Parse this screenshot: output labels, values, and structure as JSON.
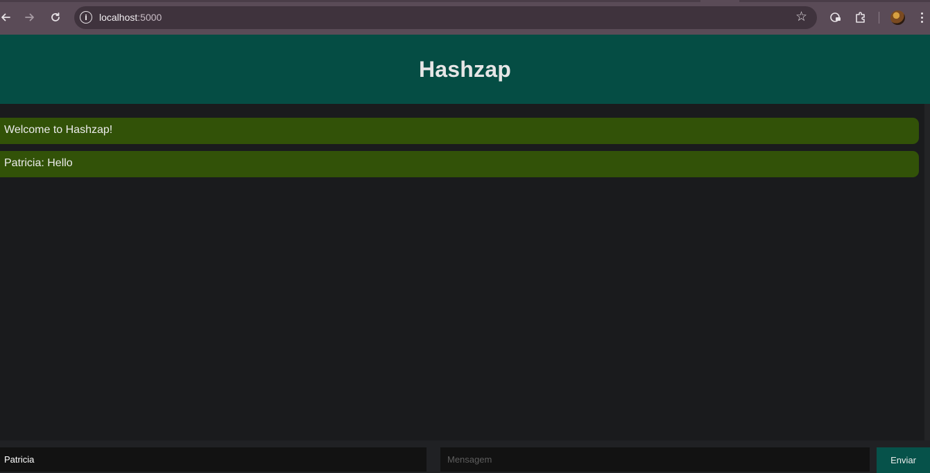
{
  "browser": {
    "url_host": "localhost",
    "url_port": ":5000",
    "icons": {
      "back": "arrow-left-icon",
      "forward": "arrow-right-icon",
      "reload": "reload-icon",
      "site_info": "info-icon",
      "bookmark": "star-icon",
      "extension_a": "guest-icon",
      "extensions": "puzzle-icon",
      "menu": "kebab-menu-icon"
    },
    "colors": {
      "frame": "#5a4b57",
      "omnibox": "#3f333d"
    }
  },
  "app": {
    "title": "Hashzap",
    "messages": [
      {
        "text": "Welcome to Hashzap!"
      },
      {
        "text": "Patricia: Hello"
      }
    ],
    "name_input": {
      "value": "Patricia",
      "placeholder": ""
    },
    "message_input": {
      "value": "",
      "placeholder": "Mensagem"
    },
    "send_label": "Enviar",
    "colors": {
      "header": "#054d44",
      "message_bubble": "#325208",
      "background": "#1a1b1d",
      "send_button": "#06524a"
    }
  }
}
